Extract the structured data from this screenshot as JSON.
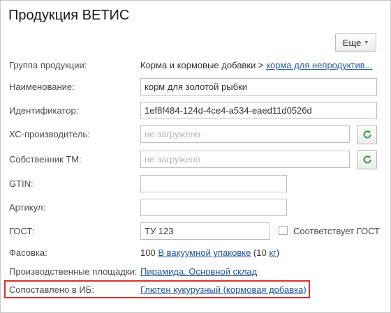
{
  "window": {
    "title": "Продукция ВЕТИС"
  },
  "toolbar": {
    "more_label": "Еще"
  },
  "fields": {
    "product_group": {
      "label": "Группа продукции:",
      "value_prefix": "Корма и кормовые добавки > ",
      "value_link": "корма для непродуктив..."
    },
    "name": {
      "label": "Наименование:",
      "value": "корм для золотой рыбки"
    },
    "identifier": {
      "label": "Идентификатор:",
      "value": "1ef8f484-124d-4ce4-a534-eaed11d0526d"
    },
    "manufacturer": {
      "label": "ХС-производитель:",
      "placeholder": "не загружено"
    },
    "tm_owner": {
      "label": "Собственник ТМ:",
      "placeholder": "не загружено"
    },
    "gtin": {
      "label": "GTIN:",
      "value": ""
    },
    "article": {
      "label": "Артикул:",
      "value": ""
    },
    "gost": {
      "label": "ГОСТ:",
      "value": "ТУ 123",
      "checkbox_label": "Соответствует ГОСТ",
      "checked": false
    },
    "packaging": {
      "label": "Фасовка:",
      "amount": "100",
      "package_link": "В вакуумной упаковке",
      "open_paren": " (10 ",
      "unit_link": "кг",
      "close_paren": ")"
    },
    "production_site": {
      "label": "Производственные площадки:",
      "value_link": "Пирамида. Основной склад"
    },
    "matched_ib": {
      "label": "Сопоставлено в ИБ:",
      "value_link": "Глютен кукурузный (кормовая добавка)"
    }
  },
  "colors": {
    "link": "#1e55a0",
    "highlight": "#d9322c",
    "refresh_icon": "#3a9a3a"
  },
  "icons": {
    "more_caret": "caret-down-icon",
    "refresh": "refresh-icon"
  }
}
